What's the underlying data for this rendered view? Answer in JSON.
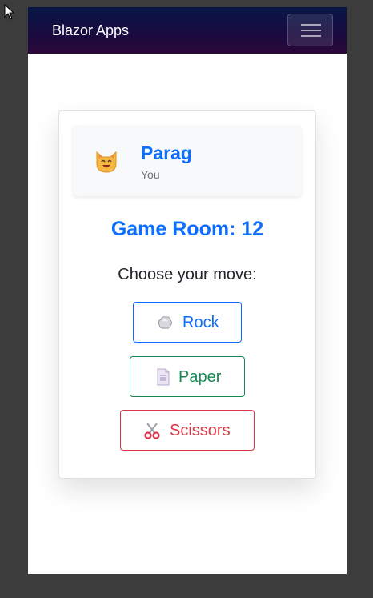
{
  "navbar": {
    "brand": "Blazor Apps",
    "toggle_icon": "hamburger-menu-icon"
  },
  "player": {
    "avatar_icon": "cat-face-emoji",
    "name": "Parag",
    "subtitle": "You"
  },
  "game": {
    "room_title": "Game Room: 12",
    "prompt": "Choose your move:"
  },
  "moves": [
    {
      "label": "Rock",
      "icon": "rock-icon",
      "color": "#0d6efd"
    },
    {
      "label": "Paper",
      "icon": "page-icon",
      "color": "#198754"
    },
    {
      "label": "Scissors",
      "icon": "scissors-icon",
      "color": "#dc3545"
    }
  ],
  "colors": {
    "accent": "#0d6efd",
    "navbar_gradient": [
      "#071646",
      "#2a0838"
    ]
  }
}
